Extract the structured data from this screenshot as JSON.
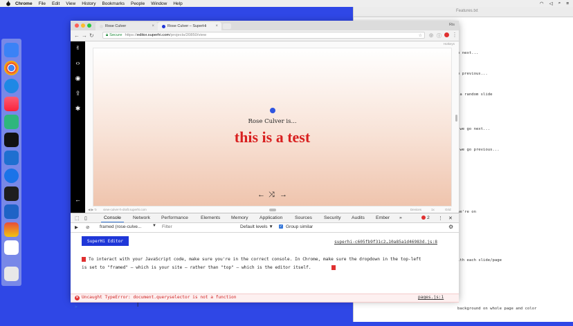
{
  "menubar": {
    "items": [
      "Chrome",
      "File",
      "Edit",
      "View",
      "History",
      "Bookmarks",
      "People",
      "Window",
      "Help"
    ]
  },
  "editor_window": {
    "title": "Features.txt",
    "lines": [
      "o next...",
      "o previous...",
      " a random slide",
      "",
      " we go next...",
      " we go previous...",
      "",
      "",
      "",
      "we're on",
      "",
      "",
      "ith each slide/page",
      "",
      "",
      "background on whole page and color"
    ]
  },
  "browser": {
    "tabs": [
      {
        "label": "Rose Culver"
      },
      {
        "label": "Rose Culver – SuperHi"
      }
    ],
    "profile": "Ris",
    "url": {
      "secure_label": "Secure",
      "scheme": "https://",
      "host": "editor.superhi.com",
      "path": "/projects/20850/view"
    },
    "preview_label": "Hotkeys",
    "slide": {
      "name": "Rose Culver is...",
      "headline": "this is a test",
      "prev_icon": "arrow-left-icon",
      "shuffle_icon": "shuffle-icon",
      "next_icon": "arrow-right-icon"
    },
    "preview_footer": {
      "url": "view-culver-h-draft.superhi.com",
      "devices": "Devices",
      "zoom": "1x",
      "grid": "Grid"
    },
    "sidebar_icons": [
      "superhi-logo-icon",
      "code-icon",
      "eye-icon",
      "share-icon",
      "gear-icon",
      "back-arrow-icon"
    ]
  },
  "devtools": {
    "tabs": [
      "Console",
      "Network",
      "Performance",
      "Elements",
      "Memory",
      "Application",
      "Sources",
      "Security",
      "Audits",
      "Ember"
    ],
    "more": "»",
    "error_count": "2",
    "context": "framed (rose-culve...",
    "filter_placeholder": "Filter",
    "levels": "Default levels ▼",
    "group_similar": "Group similar",
    "console": {
      "badge": "SuperHi Editor",
      "badge_source": "superhi-c605fb9f31c2…10a85a1d46983d.js:8",
      "info_line1": "To interact with your JavaScript code, make sure you're in the correct console. In Chrome, make sure the dropdown in the top-left",
      "info_line2": "is set to \"framed\" — which is your site — rather than \"top\" — which is the editor itself.",
      "error_text": "Uncaught TypeError: document.queryselector is not a function",
      "error_source": "pages.js:1",
      "prompt": ">"
    }
  },
  "colors": {
    "accent_blue": "#1f37d8",
    "headline_red": "#d81f1f",
    "desktop_blue": "#2f47e6"
  }
}
